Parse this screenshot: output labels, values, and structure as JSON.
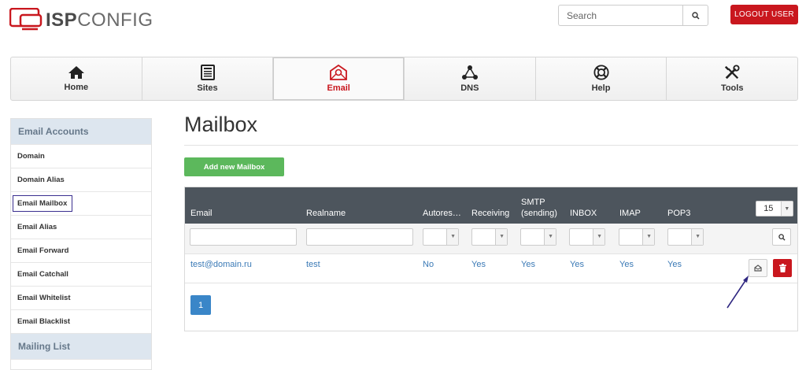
{
  "header": {
    "logo": {
      "brand_bold": "ISP",
      "brand_light": "CONFIG"
    },
    "search": {
      "placeholder": "Search"
    },
    "logout_label": "LOGOUT USER"
  },
  "topnav": {
    "items": [
      {
        "label": "Home",
        "icon": "home-icon"
      },
      {
        "label": "Sites",
        "icon": "sites-icon"
      },
      {
        "label": "Email",
        "icon": "email-icon",
        "active": true
      },
      {
        "label": "DNS",
        "icon": "dns-icon"
      },
      {
        "label": "Help",
        "icon": "help-icon"
      },
      {
        "label": "Tools",
        "icon": "tools-icon"
      }
    ]
  },
  "sidebar": {
    "section_title": "Email Accounts",
    "items": [
      {
        "label": "Domain"
      },
      {
        "label": "Domain Alias"
      },
      {
        "label": "Email Mailbox"
      },
      {
        "label": "Email Alias"
      },
      {
        "label": "Email Forward"
      },
      {
        "label": "Email Catchall"
      },
      {
        "label": "Email Whitelist"
      },
      {
        "label": "Email Blacklist"
      }
    ],
    "section2_title": "Mailing List"
  },
  "main": {
    "title": "Mailbox",
    "add_button": "Add new Mailbox",
    "table": {
      "columns": [
        "Email",
        "Realname",
        "Autores…",
        "Receiving",
        "SMTP (sending)",
        "INBOX",
        "IMAP",
        "POP3"
      ],
      "smtp_line1": "SMTP",
      "smtp_line2": "(sending)",
      "per_page": "15",
      "rows": [
        {
          "email": "test@domain.ru",
          "realname": "test",
          "autoresponder": "No",
          "receiving": "Yes",
          "smtp": "Yes",
          "inbox": "Yes",
          "imap": "Yes",
          "pop3": "Yes"
        }
      ]
    },
    "pagination": {
      "current": "1"
    }
  },
  "colors": {
    "brand_red": "#c9171e",
    "header_dark": "#4d555d",
    "link_blue": "#3b7ab6",
    "add_green": "#5cb85c",
    "pager_blue": "#3a86c8",
    "annotation": "#2e2680"
  }
}
